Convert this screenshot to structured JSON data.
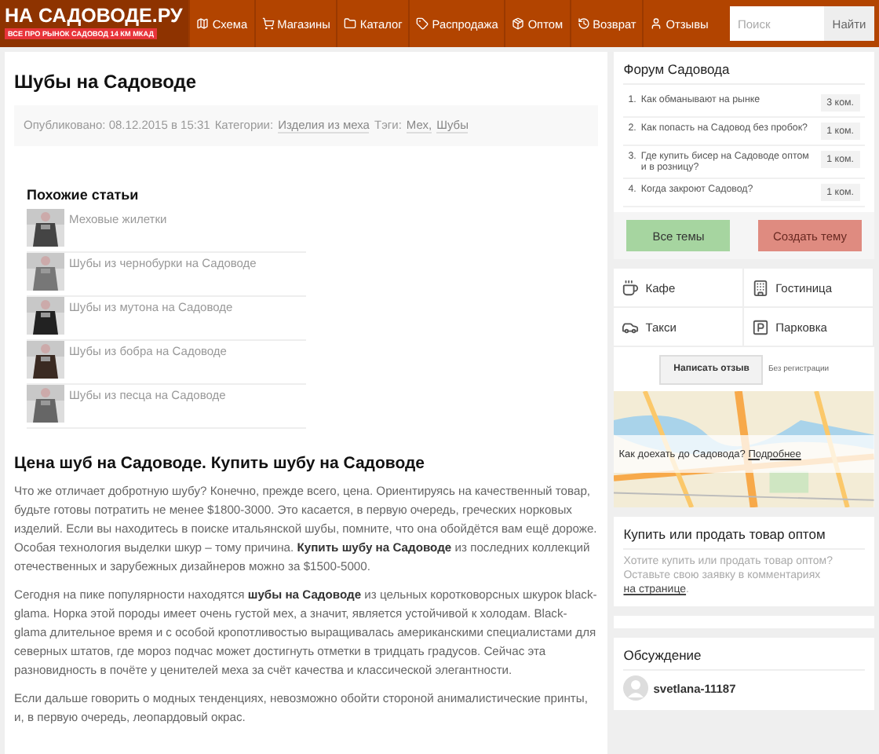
{
  "header": {
    "logo": "НА САДОВОДЕ.РУ",
    "tagline": "ВСЕ ПРО РЫНОК САДОВОД 14 КМ МКАД",
    "nav": [
      {
        "label": "Схема"
      },
      {
        "label": "Магазины"
      },
      {
        "label": "Каталог"
      },
      {
        "label": "Распродажа"
      },
      {
        "label": "Оптом"
      },
      {
        "label": "Возврат"
      },
      {
        "label": "Отзывы"
      }
    ],
    "search": {
      "placeholder": "Поиск",
      "button": "Найти"
    }
  },
  "article": {
    "title": "Шубы на Садоводе",
    "published": "Опубликовано: 08.12.2015 в 15:31",
    "categories_label": "Категории:",
    "category": "Изделия из меха",
    "tags_label": "Тэги:",
    "tags": [
      "Мех,",
      "Шубы"
    ],
    "related": {
      "heading": "Похожие статьи",
      "items": [
        {
          "title": "Меховые жилетки"
        },
        {
          "title": "Шубы из чернобурки на Садоводе"
        },
        {
          "title": "Шубы из мутона на Садоводе"
        },
        {
          "title": "Шубы из бобра на Садоводе"
        },
        {
          "title": "Шубы из песца на Садоводе"
        }
      ]
    },
    "section_heading": "Цена шуб на Садоводе. Купить шубу на Садоводе",
    "paragraphs": [
      "Что же отличает добротную шубу? Конечно, прежде всего, цена. Ориентируясь на качественный товар, будьте готовы потратить не менее $1800-3000. Это касается, в первую очередь, греческих норковых изделий. Если вы находитесь в поиске итальянской шубы, помните, что она обойдётся вам ещё дороже. Особая технология выделки шкур – тому причина. **Купить шубу на Садоводе** из последних коллекций отечественных и зарубежных дизайнеров можно за $1500-5000.",
      "Сегодня на пике популярности находятся **шубы на Садоводе** из цельных коротковорсных шкурок black-glama. Норка этой породы имеет очень густой мех, а значит, является устойчивой к холодам. Black-glama длительное время и с особой кропотливостью выращивалась американскими специалистами для северных штатов, где мороз подчас может достигнуть отметки в тридцать градусов.  Сейчас эта разновидность в почёте у ценителей меха за счёт качества и классической элегантности.",
      "Если дальше говорить о модных тенденциях, невозможно обойти стороной анималистические принты, и, в первую очередь, леопардовый окрас."
    ]
  },
  "sidebar": {
    "forum": {
      "title": "Форум Садовода",
      "topics": [
        {
          "num": "1.",
          "title": "Как обманывают на рынке",
          "count": "3 ком."
        },
        {
          "num": "2.",
          "title": "Как попасть на Садовод без пробок?",
          "count": "1 ком."
        },
        {
          "num": "3.",
          "title": "Где купить бисер на Садоводе оптом и в розницу?",
          "count": "1 ком."
        },
        {
          "num": "4.",
          "title": "Когда закроют Садовод?",
          "count": "1 ком."
        }
      ],
      "all_button": "Все темы",
      "create_button": "Создать тему"
    },
    "places": {
      "items": [
        {
          "label": "Кафе"
        },
        {
          "label": "Гостиница"
        },
        {
          "label": "Такси"
        },
        {
          "label": "Парковка"
        }
      ],
      "review_button": "Написать отзыв",
      "review_note": "Без регистрации",
      "map_question": "Как доехать до Садовода?",
      "map_link": "Подробнее"
    },
    "buy": {
      "title": "Купить или продать товар оптом",
      "text": "Хотите купить или продать товар оптом? Оставьте свою заявку в комментариях",
      "link": "на странице",
      "tail": "."
    },
    "discussion": {
      "title": "Обсуждение",
      "comments": [
        {
          "user": "svetlana-11187"
        }
      ]
    }
  }
}
